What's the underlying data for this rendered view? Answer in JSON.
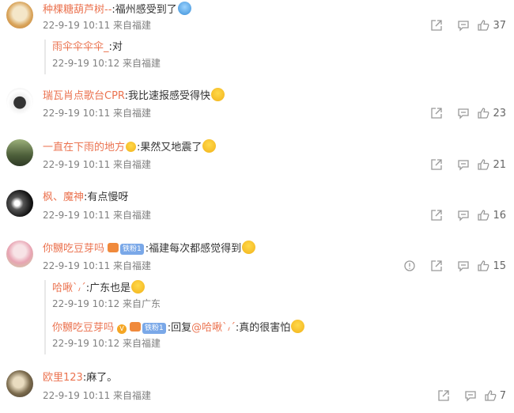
{
  "comments": [
    {
      "user": "种棵糖葫芦树--",
      "text": ":福州感受到了",
      "time": "22-9-19 10:11 来自福建",
      "likes": "37",
      "replies": [
        {
          "user": "雨伞伞伞伞_",
          "text": ":对",
          "time": "22-9-19 10:12 来自福建"
        }
      ]
    },
    {
      "user": "瑞瓦肖点歌台CPR",
      "text": ":我比速报感受得快",
      "time": "22-9-19 10:11 来自福建",
      "likes": "23"
    },
    {
      "user": "一直在下雨的地方",
      "text": ":果然又地震了",
      "time": "22-9-19 10:11 来自福建",
      "likes": "21"
    },
    {
      "user": "枫、魔神",
      "text": ":有点慢呀",
      "time": "22-9-19 10:11 来自福建",
      "likes": "16"
    },
    {
      "user": "你嬲吃豆芽吗",
      "badge": "铁粉1",
      "text": ":福建每次都感觉得到",
      "time": "22-9-19 10:11 来自福建",
      "likes": "15",
      "replies": [
        {
          "user": "哈啾ˋ៸ˊ",
          "text": ":广东也是",
          "time": "22-9-19 10:12 来自广东"
        },
        {
          "user": "你嬲吃豆芽吗",
          "badge": "铁粉1",
          "reply_prefix": ":回复",
          "reply_to": "@哈啾ˋ៸ˊ",
          "text": ":真的很害怕",
          "time": "22-9-19 10:12 来自福建"
        }
      ]
    },
    {
      "user": "欧里123",
      "text": ":麻了。",
      "time": "22-9-19 10:11 来自福建",
      "likes": "7"
    }
  ],
  "colors": {
    "username": "#eb7350",
    "meta": "#808080",
    "icon": "#999999"
  }
}
